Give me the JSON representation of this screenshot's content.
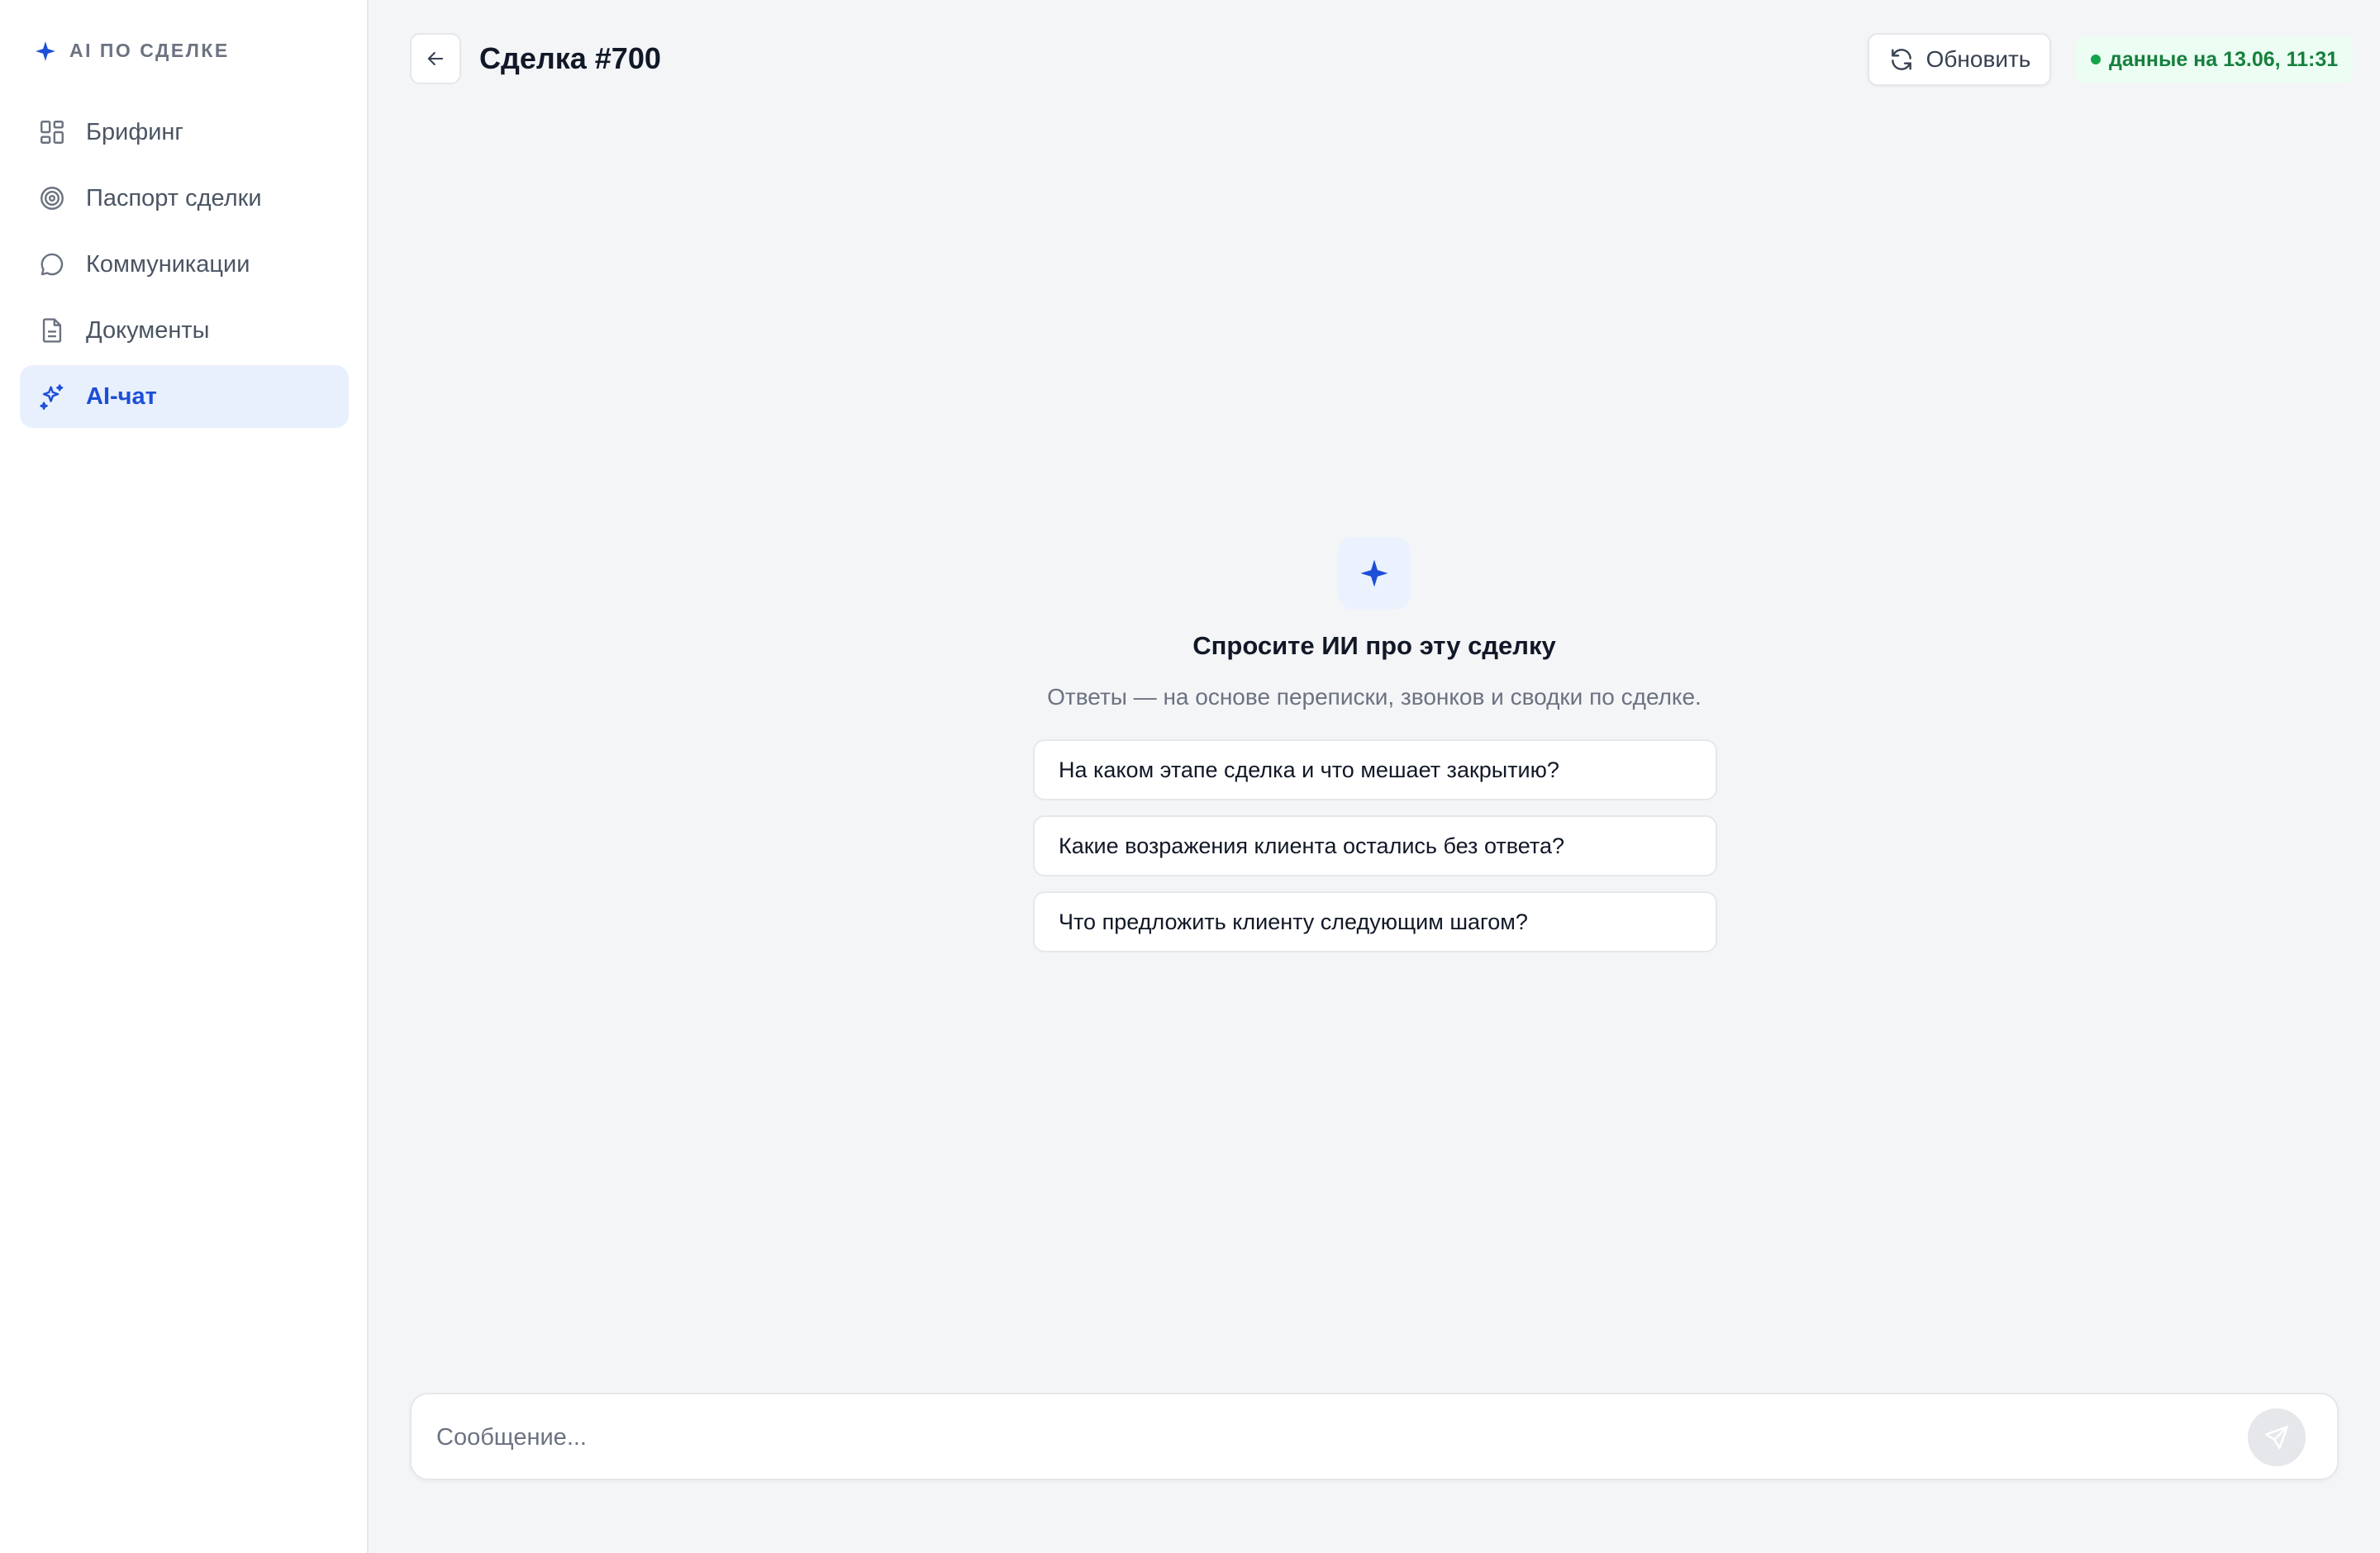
{
  "sidebar": {
    "brand": "AI ПО СДЕЛКЕ",
    "items": [
      {
        "label": "Брифинг",
        "icon": "grid-icon"
      },
      {
        "label": "Паспорт сделки",
        "icon": "target-icon"
      },
      {
        "label": "Коммуникации",
        "icon": "chat-bubble-icon"
      },
      {
        "label": "Документы",
        "icon": "document-icon"
      },
      {
        "label": "AI-чат",
        "icon": "sparkles-icon",
        "active": true
      }
    ]
  },
  "header": {
    "title": "Сделка #700",
    "refresh_label": "Обновить",
    "status": "данные на 13.06, 11:31"
  },
  "empty_state": {
    "title": "Спросите ИИ про эту сделку",
    "subtitle": "Ответы — на основе переписки, звонков и сводки по сделке.",
    "suggestions": [
      "На каком этапе сделка и что мешает закрытию?",
      "Какие возражения клиента остались без ответа?",
      "Что предложить клиенту следующим шагом?"
    ]
  },
  "composer": {
    "value": "",
    "placeholder": "Сообщение..."
  },
  "colors": {
    "accent": "#1d4ed8",
    "active_bg": "#e8f0fe",
    "status_green": "#15803d"
  }
}
